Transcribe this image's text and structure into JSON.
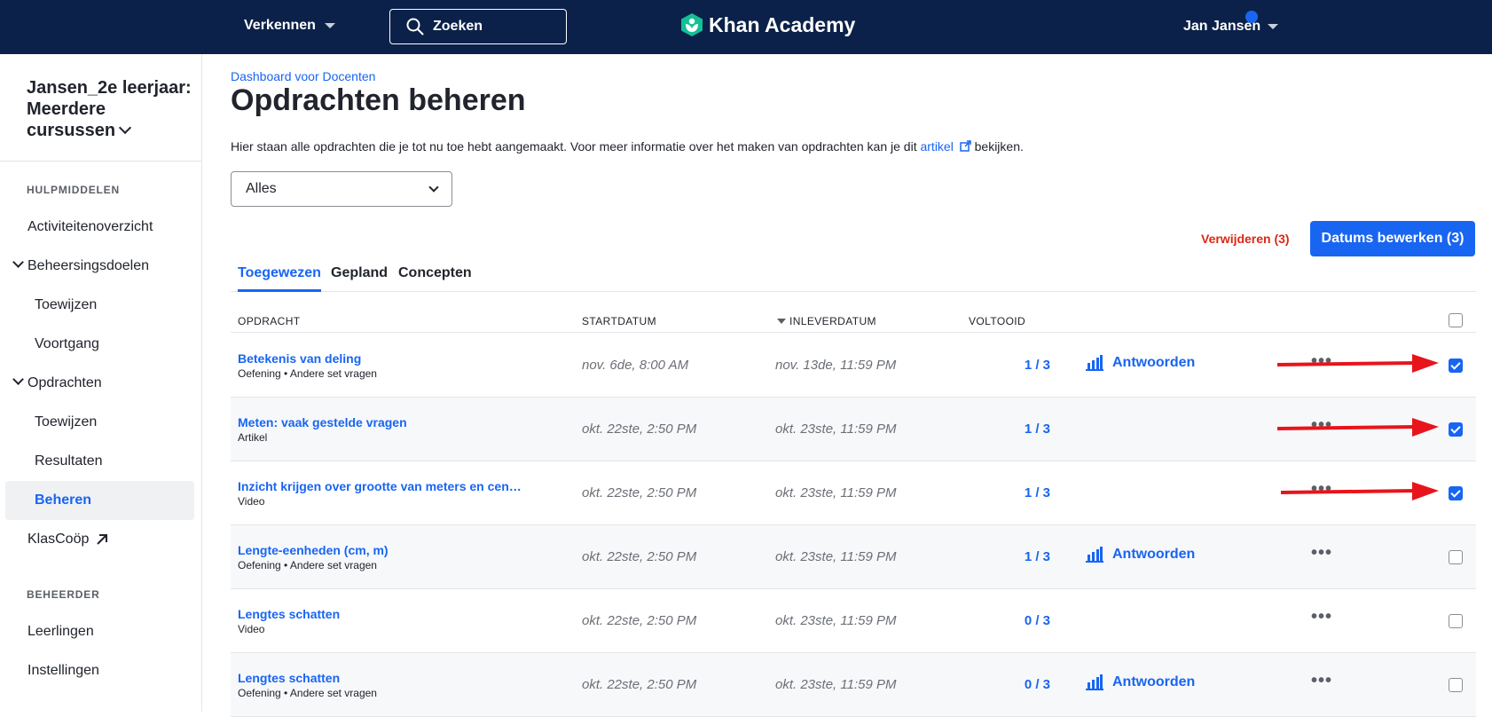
{
  "topnav": {
    "explore_label": "Verkennen",
    "search_label": "Zoeken",
    "logo_text": "Khan Academy",
    "user_name": "Jan Jansen"
  },
  "sidebar": {
    "class_title": "Jansen_2e leerjaar: Meerdere cursussen",
    "heading_resources": "HULPMIDDELEN",
    "items": [
      {
        "label": "Activiteitenoverzicht"
      },
      {
        "label": "Beheersingsdoelen"
      },
      {
        "label": "Toewijzen"
      },
      {
        "label": "Voortgang"
      },
      {
        "label": "Opdrachten"
      },
      {
        "label": "Toewijzen"
      },
      {
        "label": "Resultaten"
      },
      {
        "label": "Beheren"
      },
      {
        "label": "KlasCoöp"
      }
    ],
    "heading_admin": "BEHEERDER",
    "admin_items": [
      {
        "label": "Leerlingen"
      },
      {
        "label": "Instellingen"
      }
    ]
  },
  "main": {
    "breadcrumb": "Dashboard voor Docenten",
    "title": "Opdrachten beheren",
    "intro_before": "Hier staan alle opdrachten die je tot nu toe hebt aangemaakt. Voor meer informatie over het maken van opdrachten kan je dit ",
    "intro_link": "artikel",
    "intro_after": " bekijken.",
    "filter_value": "Alles",
    "delete_label": "Verwijderen (3)",
    "edit_dates_label": "Datums bewerken (3)",
    "tabs": [
      {
        "label": "Toegewezen"
      },
      {
        "label": "Gepland"
      },
      {
        "label": "Concepten"
      }
    ],
    "columns": {
      "assignment": "OPDRACHT",
      "start": "STARTDATUM",
      "due": "INLEVERDATUM",
      "done": "VOLTOOID"
    },
    "answers_label": "Antwoorden",
    "rows": [
      {
        "title": "Betekenis van deling",
        "sub": "Oefening • Andere set vragen",
        "start": "nov. 6de, 8:00 AM",
        "due": "nov. 13de, 11:59 PM",
        "done": "1 / 3",
        "answers": "Antwoorden",
        "checked": true
      },
      {
        "title": "Meten: vaak gestelde vragen",
        "sub": "Artikel",
        "start": "okt. 22ste, 2:50 PM",
        "due": "okt. 23ste, 11:59 PM",
        "done": "1 / 3",
        "answers": "",
        "checked": true
      },
      {
        "title": "Inzicht krijgen over grootte van meters en centimeters",
        "sub": "Video",
        "start": "okt. 22ste, 2:50 PM",
        "due": "okt. 23ste, 11:59 PM",
        "done": "1 / 3",
        "answers": "",
        "checked": true
      },
      {
        "title": "Lengte-eenheden (cm, m)",
        "sub": "Oefening • Andere set vragen",
        "start": "okt. 22ste, 2:50 PM",
        "due": "okt. 23ste, 11:59 PM",
        "done": "1 / 3",
        "answers": "Antwoorden",
        "checked": false
      },
      {
        "title": "Lengtes schatten",
        "sub": "Video",
        "start": "okt. 22ste, 2:50 PM",
        "due": "okt. 23ste, 11:59 PM",
        "done": "0 / 3",
        "answers": "",
        "checked": false
      },
      {
        "title": "Lengtes schatten",
        "sub": "Oefening • Andere set vragen",
        "start": "okt. 22ste, 2:50 PM",
        "due": "okt. 23ste, 11:59 PM",
        "done": "0 / 3",
        "answers": "Antwoorden",
        "checked": false
      }
    ]
  },
  "colors": {
    "nav_bg": "#0b2149",
    "accent": "#1865f2",
    "danger": "#d92916",
    "annotation_arrow": "#e8141b",
    "logo_green": "#14bf96"
  }
}
